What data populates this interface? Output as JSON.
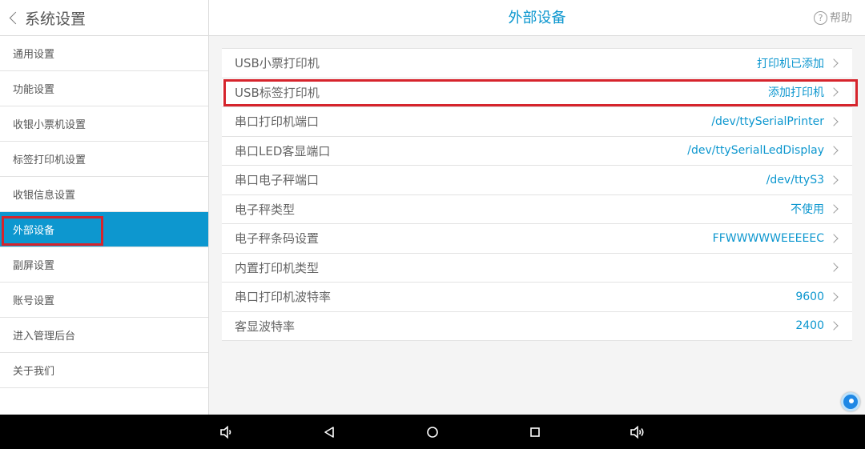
{
  "sidebar": {
    "back_label": "系统设置",
    "items": [
      {
        "label": "通用设置"
      },
      {
        "label": "功能设置"
      },
      {
        "label": "收银小票机设置"
      },
      {
        "label": "标签打印机设置"
      },
      {
        "label": "收银信息设置"
      },
      {
        "label": "外部设备"
      },
      {
        "label": "副屏设置"
      },
      {
        "label": "账号设置"
      },
      {
        "label": "进入管理后台"
      },
      {
        "label": "关于我们"
      }
    ],
    "active_item": "外部设备"
  },
  "header": {
    "title": "外部设备",
    "help_label": "帮助",
    "help_icon_glyph": "?"
  },
  "settings": [
    {
      "label": "USB小票打印机",
      "value": "打印机已添加"
    },
    {
      "label": "USB标签打印机",
      "value": "添加打印机"
    },
    {
      "label": "串口打印机端口",
      "value": "/dev/ttySerialPrinter"
    },
    {
      "label": "串口LED客显端口",
      "value": "/dev/ttySerialLedDisplay"
    },
    {
      "label": "串口电子秤端口",
      "value": "/dev/ttyS3"
    },
    {
      "label": "电子秤类型",
      "value": "不使用"
    },
    {
      "label": "电子秤条码设置",
      "value": "FFWWWWWEEEEEC"
    },
    {
      "label": "内置打印机类型",
      "value": ""
    },
    {
      "label": "串口打印机波特率",
      "value": "9600"
    },
    {
      "label": "客显波特率",
      "value": "2400"
    }
  ],
  "navbar": {
    "buttons": [
      "volume-down-icon",
      "back-icon",
      "home-icon",
      "recents-icon",
      "volume-up-icon"
    ]
  },
  "colors": {
    "accent": "#0d97cf",
    "highlight_box": "#d6242c",
    "navbar_bg": "#000000"
  }
}
